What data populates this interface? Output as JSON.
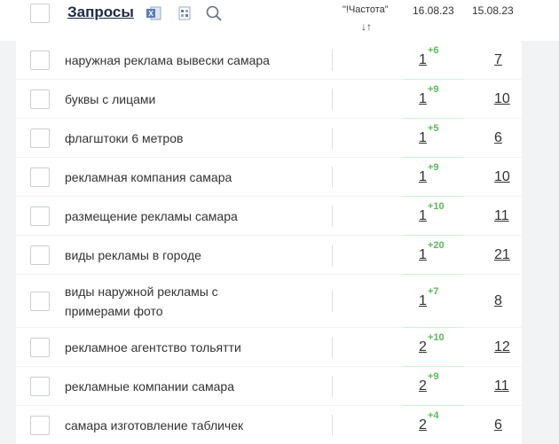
{
  "header": {
    "title": "Запросы",
    "col_frequency": "\"!Частота\"",
    "sort_glyph": "↓↑",
    "date1": "16.08.23",
    "date2": "15.08.23"
  },
  "icons": [
    "excel-icon",
    "settings-grid-icon",
    "search-icon"
  ],
  "colors": {
    "green_col": "#c8f4d6",
    "delta": "#5cb85c",
    "title": "#1e2a4a"
  },
  "rows": [
    {
      "query": "наружная реклама вывески самара",
      "pos": "1",
      "delta": "+6",
      "prev": "7"
    },
    {
      "query": "буквы с лицами",
      "pos": "1",
      "delta": "+9",
      "prev": "10"
    },
    {
      "query": "флагштоки 6 метров",
      "pos": "1",
      "delta": "+5",
      "prev": "6"
    },
    {
      "query": "рекламная компания самара",
      "pos": "1",
      "delta": "+9",
      "prev": "10"
    },
    {
      "query": "размещение рекламы самара",
      "pos": "1",
      "delta": "+10",
      "prev": "11"
    },
    {
      "query": "виды рекламы в городе",
      "pos": "1",
      "delta": "+20",
      "prev": "21"
    },
    {
      "query": [
        "виды наружной рекламы с",
        "примерами фото"
      ],
      "pos": "1",
      "delta": "+7",
      "prev": "8"
    },
    {
      "query": "рекламное агентство тольятти",
      "pos": "2",
      "delta": "+10",
      "prev": "12"
    },
    {
      "query": "рекламные компании самара",
      "pos": "2",
      "delta": "+9",
      "prev": "11"
    },
    {
      "query": "самара изготовление табличек",
      "pos": "2",
      "delta": "+4",
      "prev": "6"
    }
  ]
}
